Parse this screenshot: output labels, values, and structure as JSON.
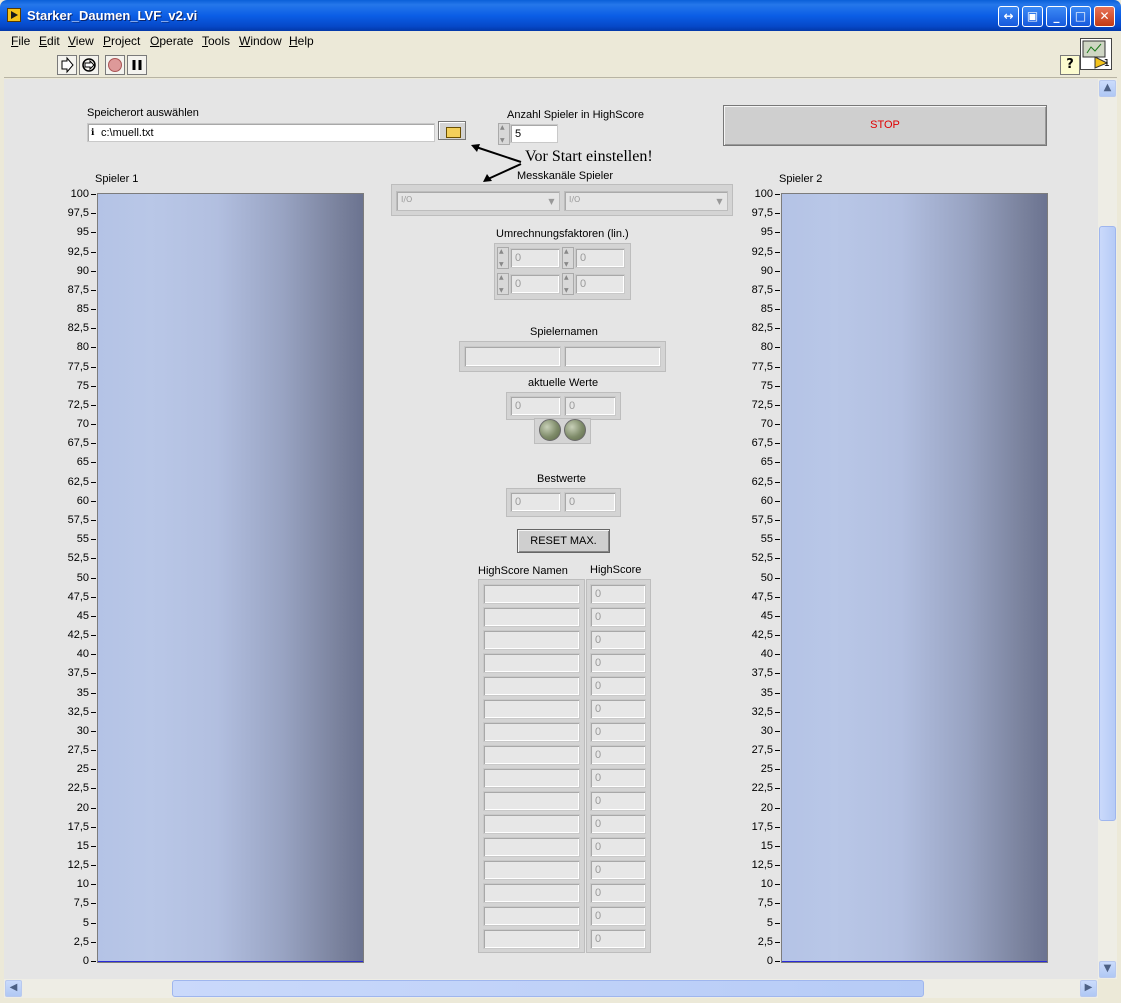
{
  "window": {
    "title": "Starker_Daumen_LVF_v2.vi"
  },
  "menu": [
    "File",
    "Edit",
    "View",
    "Project",
    "Operate",
    "Tools",
    "Window",
    "Help"
  ],
  "menu_underline": [
    "F",
    "E",
    "V",
    "P",
    "O",
    "T",
    "W",
    "H"
  ],
  "toolbar": {
    "help": "?",
    "connector_num": "1"
  },
  "file_path": {
    "label": "Speicherort auswählen",
    "value": "c:\\muell.txt"
  },
  "highscore_count": {
    "label": "Anzahl Spieler in HighScore",
    "value": "5"
  },
  "annotation": "Vor Start einstellen!",
  "stop_button": "STOP",
  "channels": {
    "label": "Messkanäle Spieler"
  },
  "factors": {
    "label": "Umrechnungsfaktoren (lin.)",
    "values": [
      "0",
      "0",
      "0",
      "0"
    ]
  },
  "names": {
    "label": "Spielernamen",
    "values": [
      "",
      ""
    ]
  },
  "current": {
    "label": "aktuelle Werte",
    "values": [
      "0",
      "0"
    ]
  },
  "best": {
    "label": "Bestwerte",
    "values": [
      "0",
      "0"
    ]
  },
  "reset_button": "RESET MAX.",
  "highscore": {
    "names_label": "HighScore Namen",
    "scores_label": "HighScore",
    "names": [
      "",
      "",
      "",
      "",
      "",
      "",
      "",
      "",
      "",
      "",
      "",
      "",
      "",
      "",
      "",
      ""
    ],
    "scores": [
      "0",
      "0",
      "0",
      "0",
      "0",
      "0",
      "0",
      "0",
      "0",
      "0",
      "0",
      "0",
      "0",
      "0",
      "0",
      "0"
    ]
  },
  "player1": {
    "label": "Spieler 1",
    "level": 0
  },
  "player2": {
    "label": "Spieler 2",
    "level": 0
  },
  "scale": [
    "100",
    "97,5",
    "95",
    "92,5",
    "90",
    "87,5",
    "85",
    "82,5",
    "80",
    "77,5",
    "75",
    "72,5",
    "70",
    "67,5",
    "65",
    "62,5",
    "60",
    "57,5",
    "55",
    "52,5",
    "50",
    "47,5",
    "45",
    "42,5",
    "40",
    "37,5",
    "35",
    "32,5",
    "30",
    "27,5",
    "25",
    "22,5",
    "20",
    "17,5",
    "15",
    "12,5",
    "10",
    "7,5",
    "5",
    "2,5",
    "0"
  ]
}
